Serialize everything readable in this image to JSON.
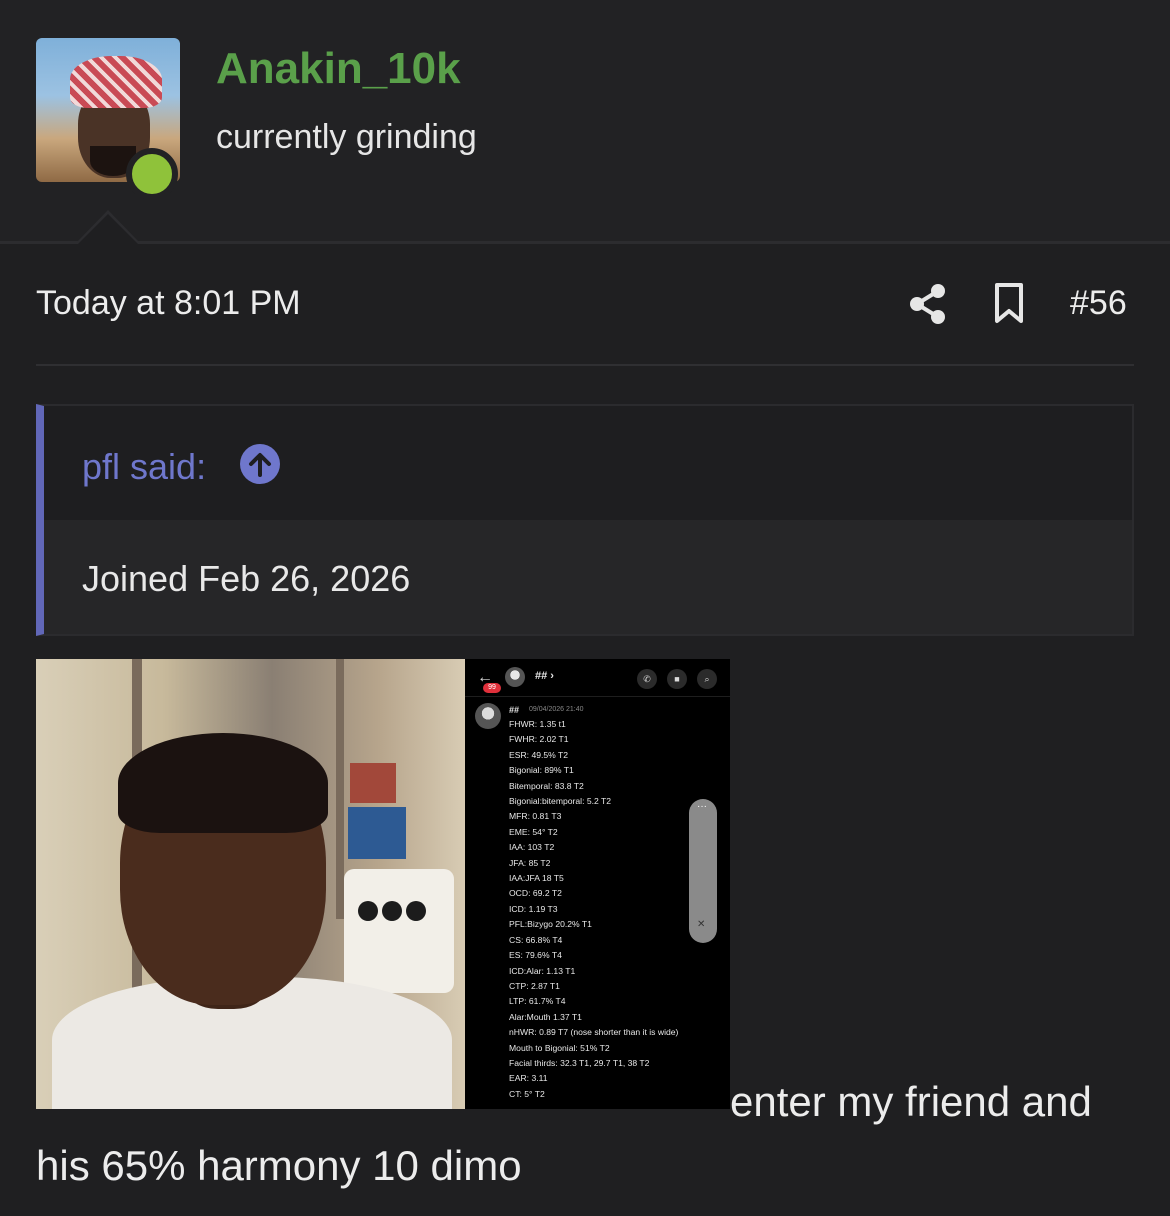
{
  "user": {
    "name": "Anakin_10k",
    "title": "currently grinding",
    "name_color": "#5aa04a",
    "online_color": "#8fc23a"
  },
  "post": {
    "date": "Today at 8:01 PM",
    "number": "#56",
    "actions": {
      "share_icon": "share-icon",
      "bookmark_icon": "bookmark-icon"
    },
    "body_text": "enter my friend and his 65% harmony 10 dimo"
  },
  "quote": {
    "author_label": "pfl said:",
    "arrow_icon": "arrow-up-circle-icon",
    "text": "Joined Feb 26, 2026",
    "accent_color": "#6167b8"
  },
  "attachment": {
    "dm": {
      "back_icon": "←",
      "badge": "99",
      "contact": "## ›",
      "sender": "##",
      "timestamp": "09/04/2026 21:40",
      "lines": [
        "FHWR: 1.35 t1",
        "FWHR: 2.02 T1",
        "ESR: 49.5% T2",
        "Bigonial: 89% T1",
        "Bitemporal: 83.8 T2",
        "Bigonial:bitemporal: 5.2 T2",
        "MFR: 0.81 T3",
        "EME: 54° T2",
        "IAA: 103 T2",
        "JFA: 85 T2",
        "IAA:JFA 18 T5",
        "OCD: 69.2 T2",
        "ICD: 1.19 T3",
        "PFL:Bizygo 20.2% T1",
        "CS: 66.8% T4",
        "ES: 79.6% T4",
        "ICD:Alar: 1.13 T1",
        "CTP: 2.87 T1",
        "LTP: 61.7% T4",
        "Alar:Mouth 1.37 T1",
        "nHWR: 0.89 T7 (nose shorter than it is wide)",
        "Mouth to Bigonial: 51% T2",
        "Facial thirds: 32.3 T1, 29.7 T1, 38 T2",
        "EAR: 3.11",
        "CT: 5° T2"
      ]
    }
  }
}
